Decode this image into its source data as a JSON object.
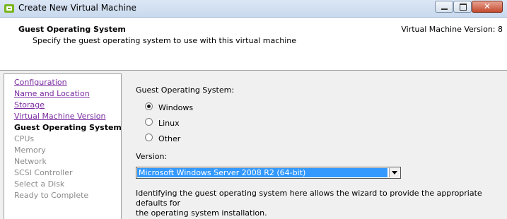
{
  "window": {
    "title": "Create New Virtual Machine",
    "close_glyph": "✕"
  },
  "header": {
    "title": "Guest Operating System",
    "subtitle": "Specify the guest operating system to use with this virtual machine",
    "version_text": "Virtual Machine Version: 8"
  },
  "nav": {
    "items": [
      {
        "label": "Configuration",
        "state": "link"
      },
      {
        "label": "Name and Location",
        "state": "link"
      },
      {
        "label": "Storage",
        "state": "link"
      },
      {
        "label": "Virtual Machine Version",
        "state": "link"
      },
      {
        "label": "Guest Operating System",
        "state": "current"
      },
      {
        "label": "CPUs",
        "state": "disabled"
      },
      {
        "label": "Memory",
        "state": "disabled"
      },
      {
        "label": "Network",
        "state": "disabled"
      },
      {
        "label": "SCSI Controller",
        "state": "disabled"
      },
      {
        "label": "Select a Disk",
        "state": "disabled"
      },
      {
        "label": "Ready to Complete",
        "state": "disabled"
      }
    ]
  },
  "form": {
    "os_label": "Guest Operating System:",
    "os_options": [
      {
        "label": "Windows",
        "checked": true
      },
      {
        "label": "Linux",
        "checked": false
      },
      {
        "label": "Other",
        "checked": false
      }
    ],
    "version_label": "Version:",
    "version_value": "Microsoft Windows Server 2008 R2 (64-bit)",
    "description_line1": "Identifying the guest operating system here allows the wizard to provide the appropriate defaults for",
    "description_line2": "the operating system installation."
  },
  "colors": {
    "link": "#7a2aa0",
    "selection": "#3399ff",
    "app_icon": "#7ab51d"
  }
}
